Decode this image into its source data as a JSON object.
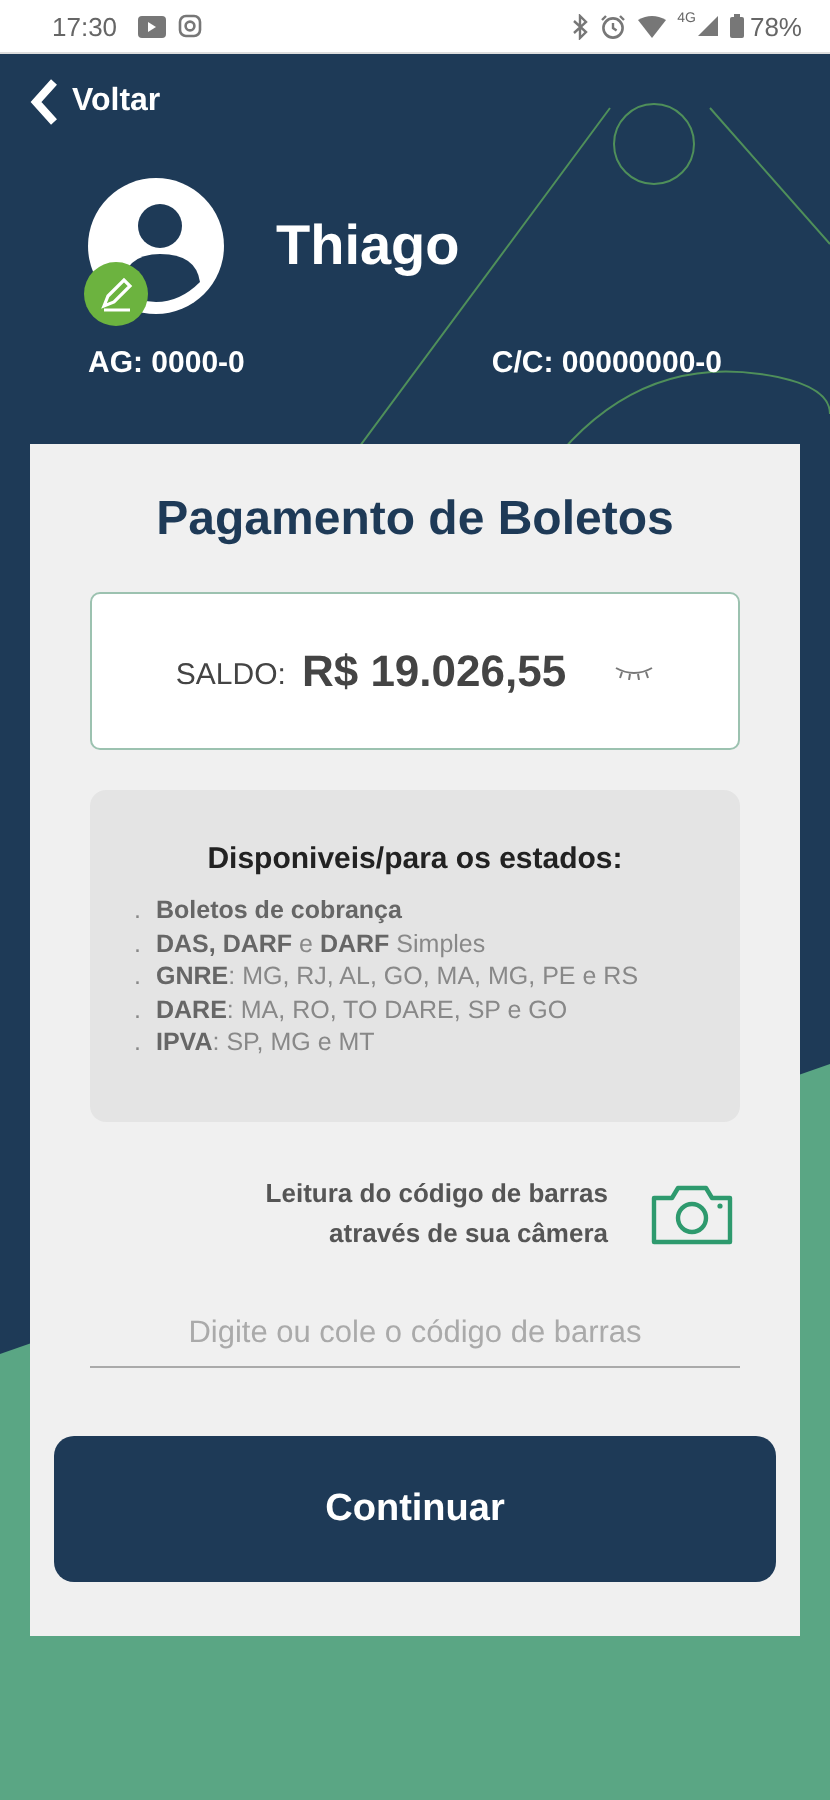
{
  "status_bar": {
    "time": "17:30",
    "network": "4G",
    "battery": "78%"
  },
  "header": {
    "back": "Voltar",
    "user_name": "Thiago",
    "agency": "AG: 0000-0",
    "account": "C/C: 00000000-0"
  },
  "card": {
    "title": "Pagamento de Boletos",
    "balance": {
      "label": "SALDO:",
      "value": "R$ 19.026,55",
      "hidden": false
    },
    "info": {
      "title": "Disponiveis/para os estados:",
      "items": [
        {
          "bullet": ".",
          "text": "**Boletos de cobrança**"
        },
        {
          "bullet": ".",
          "text": "**DAS, DARF** e **DARF** Simples"
        },
        {
          "bullet": ".",
          "text": "**GNRE**: MG, RJ, AL, GO, MA, MG, PE e RS"
        },
        {
          "bullet": ".",
          "text": "**DARE**: MA, RO, TO DARE, SP e GO"
        },
        {
          "bullet": ".",
          "text": "**IPVA**:  SP, MG e MT"
        }
      ]
    },
    "scan_label": "Leitura do código de barras através de sua câmera",
    "barcode_field": {
      "placeholder": "Digite ou cole o código de barras"
    },
    "button": "Continuar"
  }
}
